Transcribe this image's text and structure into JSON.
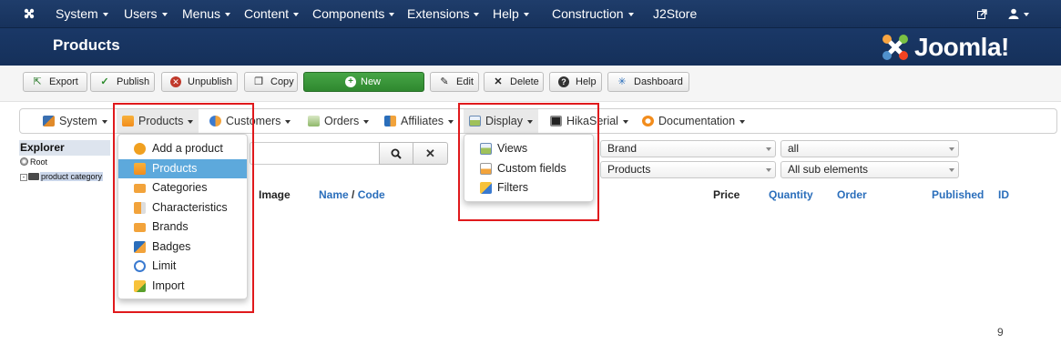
{
  "topnav": {
    "items": [
      {
        "label": "System"
      },
      {
        "label": "Users"
      },
      {
        "label": "Menus"
      },
      {
        "label": "Content"
      },
      {
        "label": "Components"
      },
      {
        "label": "Extensions"
      },
      {
        "label": "Help"
      },
      {
        "label": "Construction"
      },
      {
        "label": "J2Store"
      }
    ]
  },
  "header": {
    "title": "Products",
    "brand": "Joomla!"
  },
  "toolbar": {
    "export": "Export",
    "publish": "Publish",
    "unpublish": "Unpublish",
    "copy": "Copy",
    "new": "New",
    "edit": "Edit",
    "delete": "Delete",
    "help": "Help",
    "dashboard": "Dashboard"
  },
  "hikamenu": {
    "system": "System",
    "products": "Products",
    "customers": "Customers",
    "orders": "Orders",
    "affiliates": "Affiliates",
    "display": "Display",
    "hikaserial": "HikaSerial",
    "documentation": "Documentation"
  },
  "explorer": {
    "title": "Explorer",
    "root": "Root",
    "category": "product category"
  },
  "filters": {
    "brand": "Brand",
    "all": "all",
    "products": "Products",
    "sub": "All sub elements"
  },
  "table": {
    "image": "Image",
    "name": "Name",
    "slash": "/",
    "code": "Code",
    "price": "Price",
    "quantity": "Quantity",
    "order": "Order",
    "published": "Published",
    "id": "ID"
  },
  "products_menu": [
    {
      "label": "Add a product"
    },
    {
      "label": "Products"
    },
    {
      "label": "Categories"
    },
    {
      "label": "Characteristics"
    },
    {
      "label": "Brands"
    },
    {
      "label": "Badges"
    },
    {
      "label": "Limit"
    },
    {
      "label": "Import"
    }
  ],
  "display_menu": [
    {
      "label": "Views"
    },
    {
      "label": "Custom fields"
    },
    {
      "label": "Filters"
    }
  ],
  "footer": {
    "char": "9"
  },
  "colors": {
    "nav": "#1f3d6b",
    "accent": "#2a6ebb",
    "new_button": "#3a9a3a",
    "highlight": "#e0191c",
    "selected": "#5da9dc"
  }
}
